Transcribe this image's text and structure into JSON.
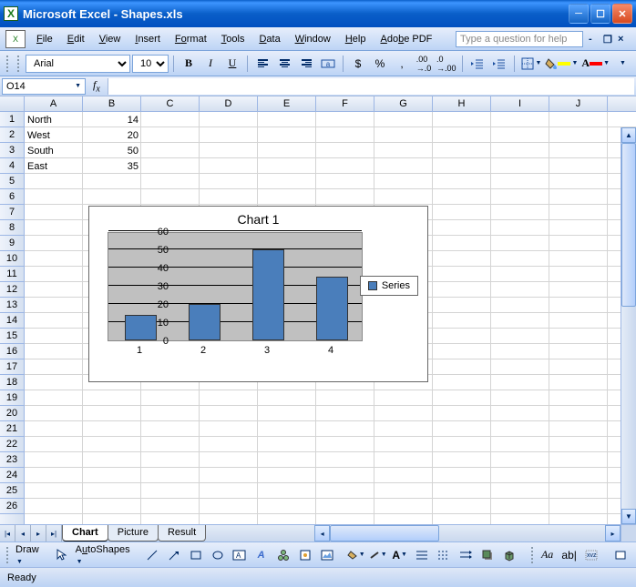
{
  "title": "Microsoft Excel - Shapes.xls",
  "menubar": [
    "File",
    "Edit",
    "View",
    "Insert",
    "Format",
    "Tools",
    "Data",
    "Window",
    "Help",
    "Adobe PDF"
  ],
  "help_placeholder": "Type a question for help",
  "font": "Arial",
  "font_size": "10",
  "namebox": "O14",
  "formula": "",
  "columns": [
    "A",
    "B",
    "C",
    "D",
    "E",
    "F",
    "G",
    "H",
    "I",
    "J"
  ],
  "rows_count": 26,
  "data_cells": [
    {
      "r": 0,
      "c": 0,
      "v": "North",
      "t": "text"
    },
    {
      "r": 1,
      "c": 0,
      "v": "West",
      "t": "text"
    },
    {
      "r": 2,
      "c": 0,
      "v": "South",
      "t": "text"
    },
    {
      "r": 3,
      "c": 0,
      "v": "East",
      "t": "text"
    },
    {
      "r": 0,
      "c": 1,
      "v": "14",
      "t": "num"
    },
    {
      "r": 1,
      "c": 1,
      "v": "20",
      "t": "num"
    },
    {
      "r": 2,
      "c": 1,
      "v": "50",
      "t": "num"
    },
    {
      "r": 3,
      "c": 1,
      "v": "35",
      "t": "num"
    }
  ],
  "chart": {
    "title": "Chart 1",
    "legend": "Series",
    "y_ticks": [
      "0",
      "10",
      "20",
      "30",
      "40",
      "50",
      "60"
    ],
    "x_ticks": [
      "1",
      "2",
      "3",
      "4"
    ]
  },
  "chart_data": {
    "type": "bar",
    "categories": [
      "1",
      "2",
      "3",
      "4"
    ],
    "values": [
      14,
      20,
      50,
      35
    ],
    "title": "Chart 1",
    "xlabel": "",
    "ylabel": "",
    "ylim": [
      0,
      60
    ],
    "series": [
      {
        "name": "Series",
        "values": [
          14,
          20,
          50,
          35
        ]
      }
    ]
  },
  "sheet_tabs": [
    {
      "name": "Chart",
      "active": true
    },
    {
      "name": "Picture",
      "active": false
    },
    {
      "name": "Result",
      "active": false
    }
  ],
  "drawbar": {
    "draw": "Draw",
    "autoshapes": "AutoShapes"
  },
  "status": "Ready"
}
